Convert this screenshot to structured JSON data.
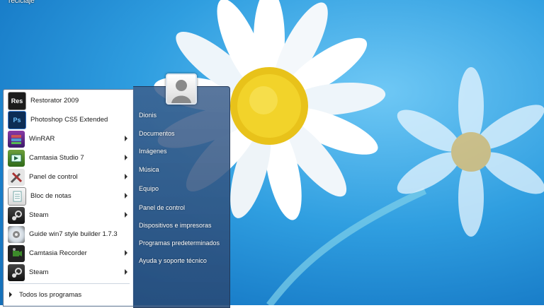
{
  "desktop": {
    "label": "reciclaje"
  },
  "start_menu": {
    "programs": [
      {
        "label": "Restorator 2009",
        "icon": "restorator-icon",
        "icon_text": "Res",
        "has_submenu": false
      },
      {
        "label": "Photoshop CS5 Extended",
        "icon": "photoshop-icon",
        "icon_text": "Ps",
        "has_submenu": false
      },
      {
        "label": "WinRAR",
        "icon": "winrar-icon",
        "icon_text": "",
        "has_submenu": true
      },
      {
        "label": "Camtasia Studio 7",
        "icon": "camtasia-icon",
        "icon_text": "",
        "has_submenu": true
      },
      {
        "label": "Panel de control",
        "icon": "tools-icon",
        "icon_text": "",
        "has_submenu": true
      },
      {
        "label": "Bloc de notas",
        "icon": "notepad-icon",
        "icon_text": "",
        "has_submenu": true
      },
      {
        "label": "Steam",
        "icon": "steam-icon",
        "icon_text": "",
        "has_submenu": true
      },
      {
        "label": "Guide win7 style builder 1.7.3",
        "icon": "guide-icon",
        "icon_text": "",
        "has_submenu": false
      },
      {
        "label": "Camtasia Recorder",
        "icon": "camera-icon",
        "icon_text": "",
        "has_submenu": true
      },
      {
        "label": "Steam",
        "icon": "steam-icon",
        "icon_text": "",
        "has_submenu": true
      }
    ],
    "all_programs": "Todos los programas",
    "right_links": [
      "Dionis",
      "Documentos",
      "Imágenes",
      "Música",
      "Equipo",
      "Panel de control",
      "Dispositivos e impresoras",
      "Programas predeterminados",
      "Ayuda y soporte técnico"
    ]
  }
}
